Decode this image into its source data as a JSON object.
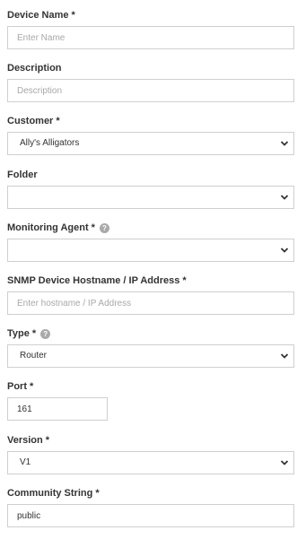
{
  "device_name": {
    "label": "Device Name *",
    "placeholder": "Enter Name",
    "value": ""
  },
  "description": {
    "label": "Description",
    "placeholder": "Description",
    "value": ""
  },
  "customer": {
    "label": "Customer *",
    "selected": "Ally's Alligators"
  },
  "folder": {
    "label": "Folder",
    "selected": ""
  },
  "monitoring_agent": {
    "label": "Monitoring Agent *",
    "help_icon": "?",
    "selected": ""
  },
  "snmp_host": {
    "label": "SNMP Device Hostname / IP Address *",
    "placeholder": "Enter hostname / IP Address",
    "value": ""
  },
  "type": {
    "label": "Type *",
    "help_icon": "?",
    "selected": "Router"
  },
  "port": {
    "label": "Port *",
    "value": "161"
  },
  "version": {
    "label": "Version *",
    "selected": "V1"
  },
  "community_string": {
    "label": "Community String *",
    "value": "public"
  },
  "colors": {
    "border": "#cfcfcf",
    "label": "#333333",
    "placeholder": "#a8a8a8",
    "help_icon": "#a9a9a9"
  },
  "icons": {
    "dropdown": "chevron-down-icon",
    "help": "help-icon"
  }
}
